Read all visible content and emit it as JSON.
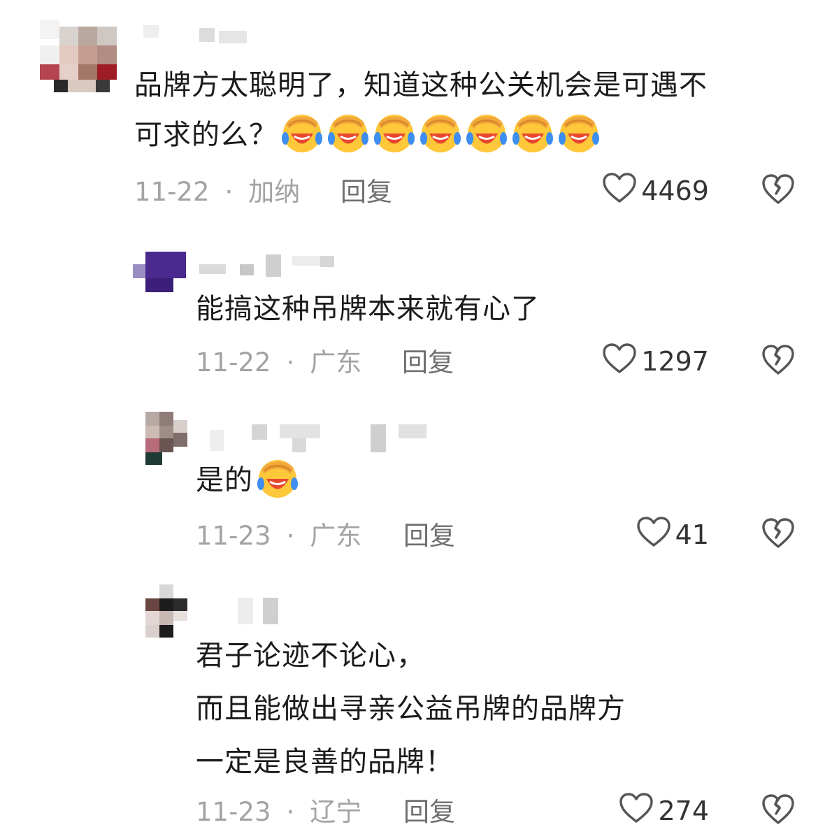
{
  "comments": [
    {
      "text_lines": [
        "品牌方太聪明了，知道这种公关机会是可遇不",
        "可求的么？"
      ],
      "emoji_count": 7,
      "date": "11-22",
      "location": "加纳",
      "reply_label": "回复",
      "likes": "4469"
    },
    {
      "text_lines": [
        "能搞这种吊牌本来就有心了"
      ],
      "emoji_count": 0,
      "date": "11-22",
      "location": "广东",
      "reply_label": "回复",
      "likes": "1297"
    },
    {
      "text_lines": [
        "是的"
      ],
      "emoji_count": 1,
      "date": "11-23",
      "location": "广东",
      "reply_label": "回复",
      "likes": "41"
    },
    {
      "text_lines": [
        "君子论迹不论心，",
        "而且能做出寻亲公益吊牌的品牌方",
        "一定是良善的品牌！"
      ],
      "emoji_count": 0,
      "date": "11-23",
      "location": "辽宁",
      "reply_label": "回复",
      "likes": "274"
    }
  ],
  "colors": {
    "text": "#1b1b1b",
    "meta": "#a3a3a3",
    "reply": "#6f6f6f",
    "icon": "#555555",
    "emoji_face": "#ffc73a",
    "emoji_mouth": "#e8462e",
    "emoji_tears": "#3d8ef0"
  },
  "icons": {
    "like": "heart-outline-icon",
    "dislike": "broken-heart-icon",
    "emoji": "facepalm-laugh-cry-emoji"
  }
}
